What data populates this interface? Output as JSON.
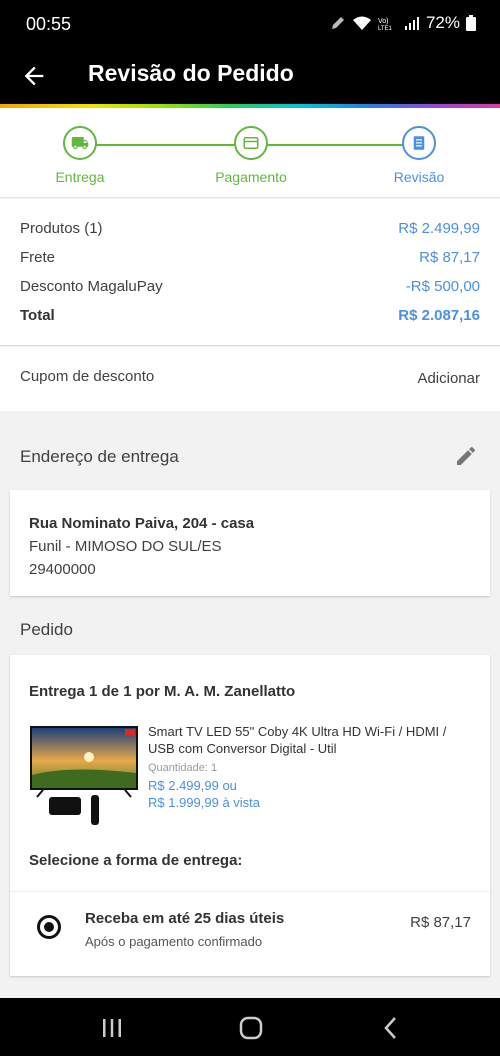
{
  "status_bar": {
    "time": "00:55",
    "battery": "72%"
  },
  "app_bar": {
    "title": "Revisão do Pedido"
  },
  "steps": [
    {
      "label": "Entrega",
      "icon": "truck-icon"
    },
    {
      "label": "Pagamento",
      "icon": "credit-card-icon"
    },
    {
      "label": "Revisão",
      "icon": "document-icon"
    }
  ],
  "summary": {
    "products_label": "Produtos (1)",
    "products_value": "R$ 2.499,99",
    "shipping_label": "Frete",
    "shipping_value": "R$ 87,17",
    "discount_label": "Desconto MagaluPay",
    "discount_value": "-R$ 500,00",
    "total_label": "Total",
    "total_value": "R$ 2.087,16"
  },
  "coupon": {
    "label": "Cupom de desconto",
    "action": "Adicionar"
  },
  "address": {
    "title": "Endereço de entrega",
    "street": "Rua Nominato Paiva, 204 - casa",
    "city": "Funil - MIMOSO DO SUL/ES",
    "zip": "29400000"
  },
  "order": {
    "title": "Pedido",
    "seller": "Entrega 1 de 1 por M. A. M. Zanellatto",
    "product_name": "Smart TV LED 55\" Coby 4K Ultra HD Wi-Fi / HDMI / USB com Conversor Digital - Util",
    "quantity": "Quantidade:  1",
    "price_installments": "R$ 2.499,99 ou",
    "price_cash": "R$ 1.999,99 à vista",
    "shipping_select_title": "Selecione a forma de entrega:",
    "shipping_option_main": "Receba em até 25 dias úteis",
    "shipping_option_sub": "Após o pagamento confirmado",
    "shipping_option_price": "R$ 87,17"
  },
  "colors": {
    "accent_blue": "#4a90e2",
    "step_green": "#62b83a"
  }
}
